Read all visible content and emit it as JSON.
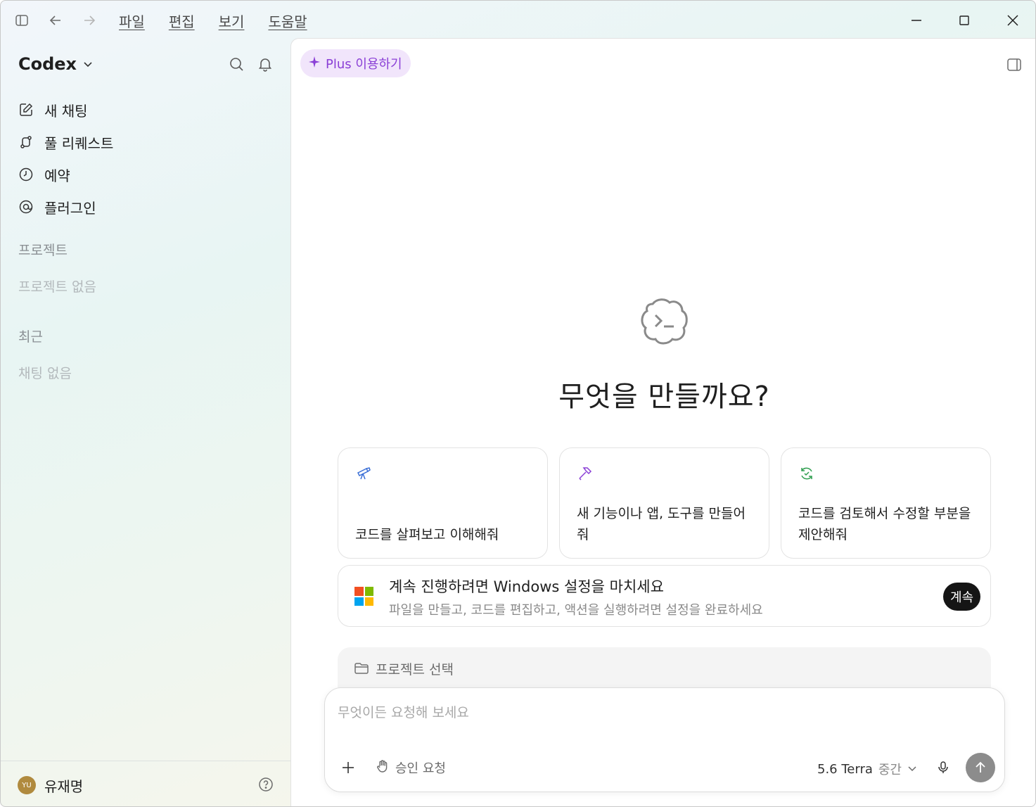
{
  "titlebar": {
    "menu": [
      "파일",
      "편집",
      "보기",
      "도움말"
    ]
  },
  "sidebar": {
    "brand": "Codex",
    "nav": [
      {
        "label": "새 채팅",
        "icon": "edit-icon"
      },
      {
        "label": "풀 리퀘스트",
        "icon": "pull-request-icon"
      },
      {
        "label": "예약",
        "icon": "clock-icon"
      },
      {
        "label": "플러그인",
        "icon": "plugin-icon"
      }
    ],
    "projects_title": "프로젝트",
    "projects_empty": "프로젝트 없음",
    "recent_title": "최근",
    "recent_empty": "채팅 없음",
    "user": {
      "initials": "YU",
      "name": "유재명"
    }
  },
  "main": {
    "plus_label": "Plus 이용하기",
    "hero_title": "무엇을 만들까요?",
    "cards": [
      {
        "text": "코드를 살펴보고 이해해줘",
        "icon": "telescope-icon",
        "color": "#3b6fd6"
      },
      {
        "text": "새 기능이나 앱, 도구를 만들어 줘",
        "icon": "hammer-icon",
        "color": "#8a3fd6"
      },
      {
        "text": "코드를 검토해서 수정할 부분을 제안해줘",
        "icon": "review-icon",
        "color": "#2e9e4f"
      }
    ],
    "setup": {
      "title": "계속 진행하려면 Windows 설정을 마치세요",
      "subtitle": "파일을 만들고, 코드를 편집하고, 액션을 실행하려면 설정을 완료하세요",
      "button": "계속"
    },
    "project_select": "프로젝트 선택",
    "composer": {
      "placeholder": "무엇이든 요청해 보세요",
      "approval": "승인 요청",
      "model": "5.6 Terra",
      "effort": "중간"
    }
  }
}
